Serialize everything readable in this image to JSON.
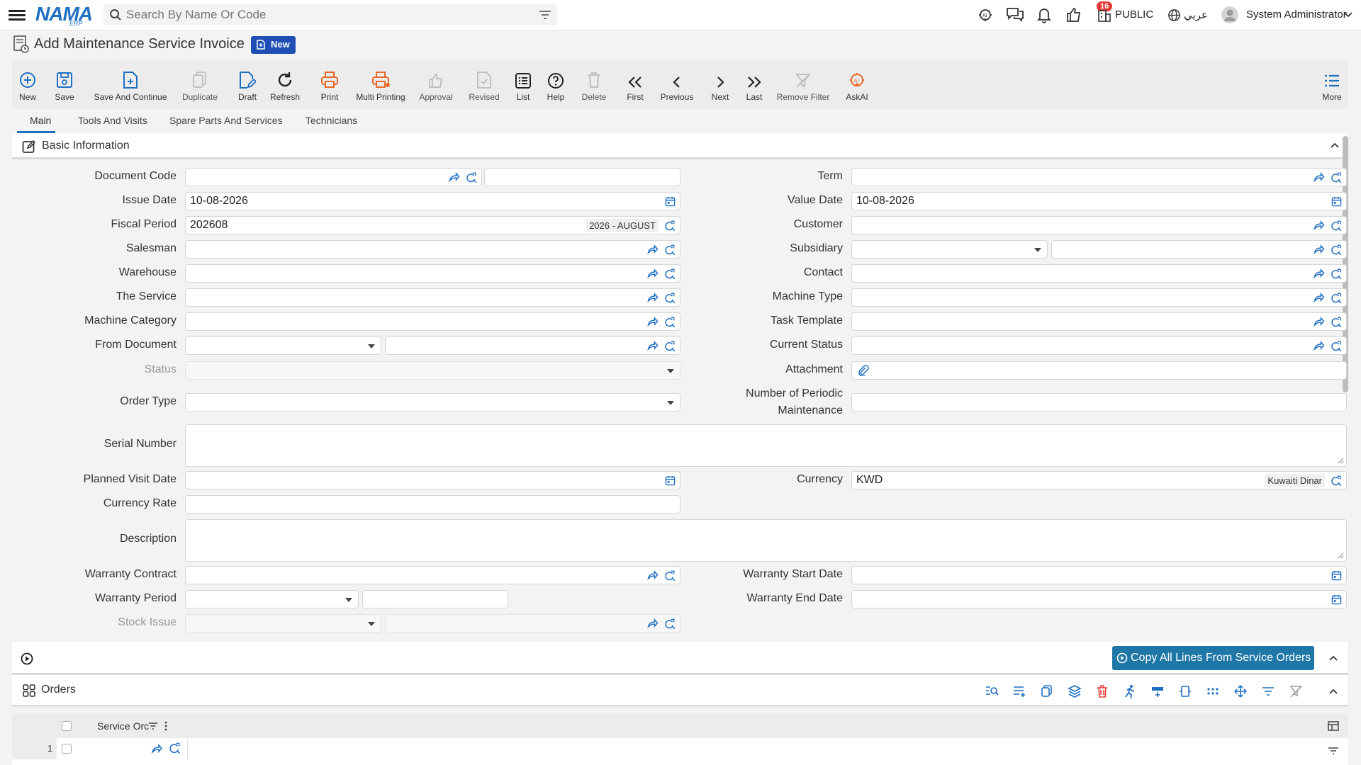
{
  "header": {
    "search_placeholder": "Search By Name Or Code",
    "notification_count": "16",
    "company": "PUBLIC",
    "language": "عربي",
    "user": "System Administrator"
  },
  "page": {
    "title": "Add Maintenance Service Invoice",
    "status_badge": "New"
  },
  "toolbar": {
    "new": "New",
    "save": "Save",
    "save_continue": "Save And Continue",
    "duplicate": "Duplicate",
    "draft": "Draft",
    "refresh": "Refresh",
    "print": "Print",
    "multi_print": "Multi Printing",
    "approval": "Approval",
    "revised": "Revised",
    "list": "List",
    "help": "Help",
    "delete": "Delete",
    "first": "First",
    "previous": "Previous",
    "next": "Next",
    "last": "Last",
    "remove_filter": "Remove Filter",
    "askai": "AskAI",
    "more": "More"
  },
  "tabs": [
    "Main",
    "Tools And Visits",
    "Spare Parts And Services",
    "Technicians"
  ],
  "basic_info": {
    "title": "Basic Information",
    "labels": {
      "document_code": "Document Code",
      "issue_date": "Issue Date",
      "fiscal_period": "Fiscal Period",
      "salesman": "Salesman",
      "warehouse": "Warehouse",
      "the_service": "The Service",
      "machine_category": "Machine Category",
      "from_document": "From Document",
      "status": "Status",
      "order_type": "Order Type",
      "serial_number": "Serial Number",
      "planned_visit_date": "Planned Visit Date",
      "currency_rate": "Currency Rate",
      "description": "Description",
      "warranty_contract": "Warranty Contract",
      "warranty_period": "Warranty Period",
      "stock_issue": "Stock Issue",
      "term": "Term",
      "value_date": "Value Date",
      "customer": "Customer",
      "subsidiary": "Subsidiary",
      "contact": "Contact",
      "machine_type": "Machine Type",
      "task_template": "Task Template",
      "current_status": "Current Status",
      "attachment": "Attachment",
      "periodic_1": "Number of Periodic",
      "periodic_2": "Maintenance",
      "currency": "Currency",
      "warranty_start": "Warranty Start Date",
      "warranty_end": "Warranty End Date"
    },
    "values": {
      "issue_date": "10-08-2026",
      "value_date": "10-08-2026",
      "fiscal_period": "202608",
      "fiscal_period_name": "2026 - AUGUST",
      "currency": "KWD",
      "currency_name": "Kuwaiti Dinar"
    }
  },
  "copy_button": "Copy All Lines From Service Orders",
  "orders": {
    "title": "Orders",
    "column": "Service Orc",
    "row_number": "1"
  },
  "colors": {
    "accent": "#1f6fc3",
    "orange": "#e8692b",
    "copy_btn": "#1f77a8",
    "badge": "#e53935"
  }
}
